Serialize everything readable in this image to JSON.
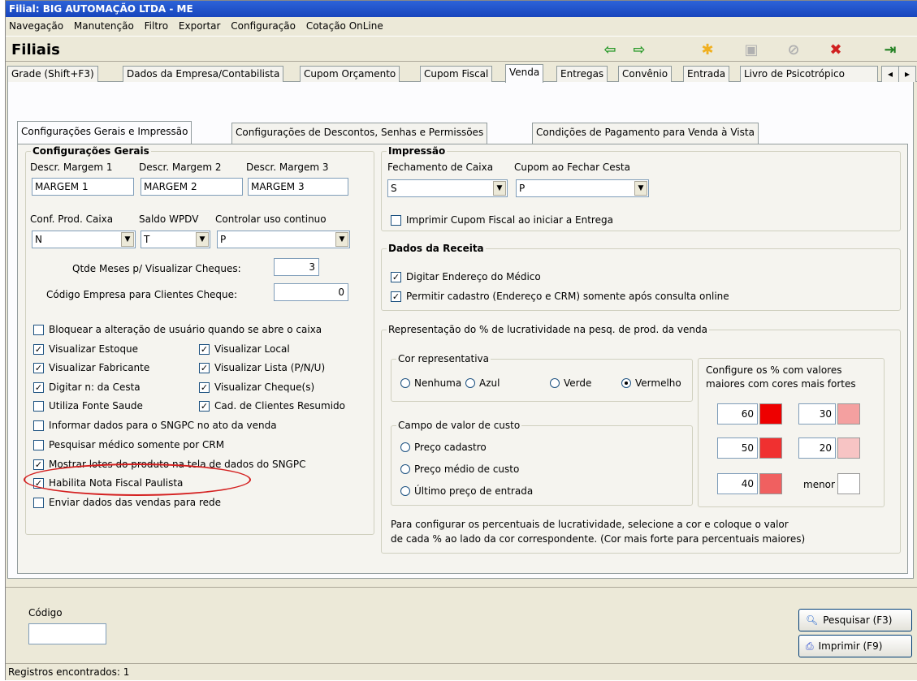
{
  "window": {
    "title": "Filial: BIG AUTOMAÇÃO LTDA - ME"
  },
  "menu": [
    "Navegação",
    "Manutenção",
    "Filtro",
    "Exportar",
    "Configuração",
    "Cotação OnLine"
  ],
  "toolbar": {
    "title": "Filiais"
  },
  "tabs": [
    "Grade (Shift+F3)",
    "Dados da Empresa/Contabilista",
    "Cupom Orçamento",
    "Cupom Fiscal",
    "Venda",
    "Entregas",
    "Convênio",
    "Entrada",
    "Livro de Psicotrópico"
  ],
  "subtabs": [
    "Configurações Gerais e Impressão",
    "Configurações de Descontos, Senhas e Permissões",
    "Condições de Pagamento para Venda à Vista"
  ],
  "config": {
    "legend": "Configurações Gerais",
    "margem1_label": "Descr. Margem 1",
    "margem1": "MARGEM 1",
    "margem2_label": "Descr. Margem 2",
    "margem2": "MARGEM 2",
    "margem3_label": "Descr. Margem 3",
    "margem3": "MARGEM 3",
    "conf_prod_label": "Conf. Prod. Caixa",
    "conf_prod": "N",
    "saldo_label": "Saldo WPDV",
    "saldo": "T",
    "controlar_label": "Controlar uso continuo",
    "controlar": "P",
    "qtde_label": "Qtde Meses p/ Visualizar Cheques:",
    "qtde": "3",
    "codigo_emp_label": "Código Empresa para Clientes Cheque:",
    "codigo_emp": "0",
    "checks": {
      "bloquear": "Bloquear a alteração de usuário quando se abre o caixa",
      "vis_estoque": "Visualizar Estoque",
      "vis_local": "Visualizar Local",
      "vis_fabricante": "Visualizar Fabricante",
      "vis_lista": "Visualizar Lista (P/N/U)",
      "digitar_cesta": "Digitar n: da Cesta",
      "vis_cheques": "Visualizar Cheque(s)",
      "fonte_saude": "Utiliza Fonte Saude",
      "cad_clientes": "Cad. de Clientes Resumido",
      "sngpc": "Informar dados para o SNGPC no ato da venda",
      "pesquisar_crm": "Pesquisar médico somente por CRM",
      "mostrar_lotes": "Mostrar lotes do produto na tela de dados do SNGPC",
      "nota_paulista": "Habilita Nota Fiscal Paulista",
      "enviar_dados": "Enviar dados das vendas para rede"
    }
  },
  "impressao": {
    "legend": "Impressão",
    "fechamento_label": "Fechamento de Caixa",
    "fechamento": "S",
    "cupom_label": "Cupom ao Fechar Cesta",
    "cupom": "P",
    "imprimir_entrega": "Imprimir Cupom Fiscal ao iniciar a Entrega"
  },
  "receita": {
    "legend": "Dados da Receita",
    "digitar_endereco": "Digitar Endereço do Médico",
    "permitir_cadastro": "Permitir cadastro (Endereço e CRM) somente após consulta online"
  },
  "lucro": {
    "legend": "Representação do % de lucratividade na pesq. de prod. da venda",
    "cor_legend": "Cor representativa",
    "cores": [
      "Nenhuma",
      "Azul",
      "Verde",
      "Vermelho"
    ],
    "custo_legend": "Campo de valor de custo",
    "custos": [
      "Preço cadastro",
      "Preço médio de custo",
      "Último preço de entrada"
    ],
    "config_text1": "Configure os % com valores",
    "config_text2": "maiores com cores mais fortes",
    "values": [
      "60",
      "30",
      "50",
      "20",
      "40"
    ],
    "menor": "menor",
    "help1": "Para configurar os percentuais de lucratividade, selecione a cor e coloque o valor",
    "help2": "de cada % ao lado da cor correspondente. (Cor mais forte para percentuais maiores)",
    "colors": [
      "#ee0000",
      "#f4a0a0",
      "#f03030",
      "#f7c4c4",
      "#f06060",
      "#ffffff"
    ]
  },
  "bottom": {
    "codigo_label": "Código",
    "pesquisar": "Pesquisar (F3)",
    "imprimir": "Imprimir (F9)"
  },
  "status": "Registros encontrados: 1"
}
